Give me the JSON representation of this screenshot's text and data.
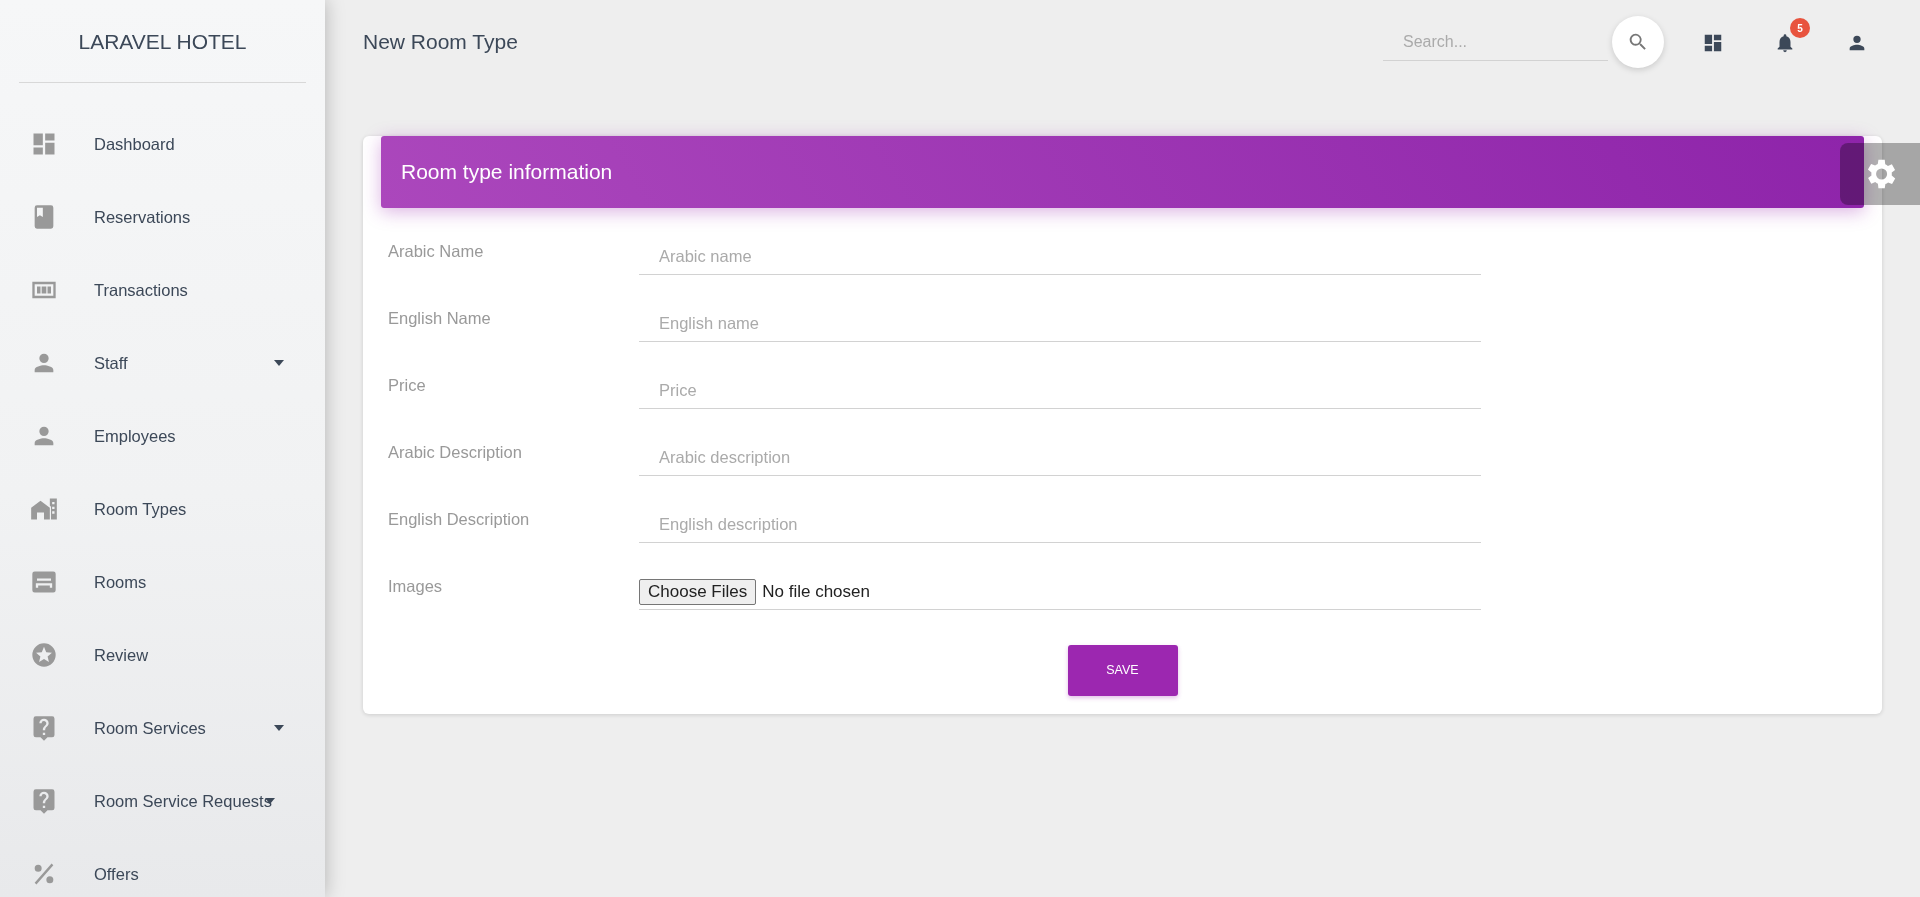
{
  "sidebar": {
    "brand": "LARAVEL HOTEL",
    "items": [
      {
        "label": "Dashboard",
        "expandable": false
      },
      {
        "label": "Reservations",
        "expandable": false
      },
      {
        "label": "Transactions",
        "expandable": false
      },
      {
        "label": "Staff",
        "expandable": true
      },
      {
        "label": "Employees",
        "expandable": false
      },
      {
        "label": "Room Types",
        "expandable": false
      },
      {
        "label": "Rooms",
        "expandable": false
      },
      {
        "label": "Review",
        "expandable": false
      },
      {
        "label": "Room Services",
        "expandable": true
      },
      {
        "label": "Room Service Requests",
        "expandable": true
      },
      {
        "label": "Offers",
        "expandable": false
      }
    ]
  },
  "topbar": {
    "title": "New Room Type",
    "search": {
      "placeholder": "Search..."
    },
    "notification_count": "5"
  },
  "card": {
    "title": "Room type information",
    "fields": [
      {
        "label": "Arabic Name",
        "kind": "text",
        "placeholder": "Arabic name"
      },
      {
        "label": "English Name",
        "kind": "text",
        "placeholder": "English name"
      },
      {
        "label": "Price",
        "kind": "text",
        "placeholder": "Price"
      },
      {
        "label": "Arabic Description",
        "kind": "text",
        "placeholder": "Arabic description"
      },
      {
        "label": "English Description",
        "kind": "text",
        "placeholder": "English description"
      },
      {
        "label": "Images",
        "kind": "file",
        "button": "Choose Files",
        "status": "No file chosen"
      }
    ],
    "save": "SAVE"
  }
}
